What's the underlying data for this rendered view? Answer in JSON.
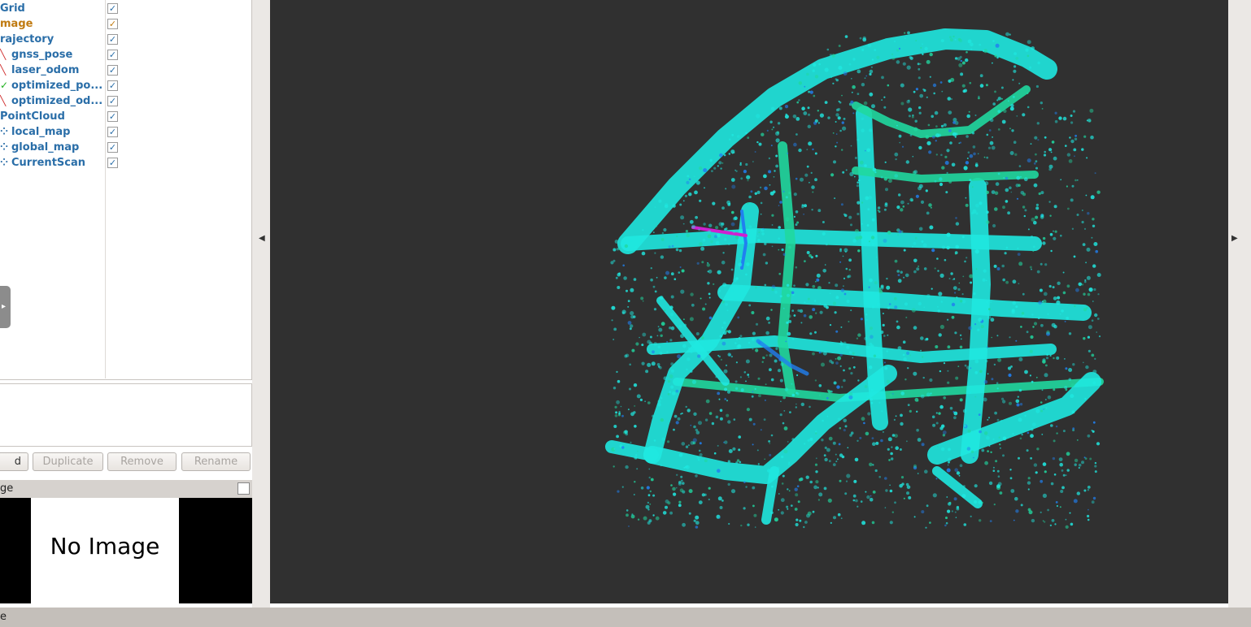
{
  "displays": {
    "items": [
      {
        "label": "Grid",
        "indent": 0,
        "icon": "",
        "checked": "✓",
        "color": "blue"
      },
      {
        "label": "mage",
        "indent": 0,
        "icon": "",
        "checked": "✓",
        "color": "orange"
      },
      {
        "label": "rajectory",
        "indent": 0,
        "icon": "",
        "checked": "✓",
        "color": "blue"
      },
      {
        "label": "gnss_pose",
        "indent": 1,
        "icon": "╲",
        "icon_color": "#d03030",
        "checked": "✓",
        "color": "blue"
      },
      {
        "label": "laser_odom",
        "indent": 1,
        "icon": "╲",
        "icon_color": "#d03030",
        "checked": "✓",
        "color": "blue"
      },
      {
        "label": "optimized_po...",
        "indent": 1,
        "icon": "✓",
        "icon_color": "#20b020",
        "checked": "✓",
        "color": "blue"
      },
      {
        "label": "optimized_od...",
        "indent": 1,
        "icon": "╲",
        "icon_color": "#d03030",
        "checked": "✓",
        "color": "blue"
      },
      {
        "label": "PointCloud",
        "indent": 0,
        "icon": "",
        "checked": "✓",
        "color": "blue"
      },
      {
        "label": "local_map",
        "indent": 1,
        "icon": "⁘",
        "icon_color": "#2a6ea8",
        "checked": "✓",
        "color": "blue"
      },
      {
        "label": "global_map",
        "indent": 1,
        "icon": "⁘",
        "icon_color": "#2a6ea8",
        "checked": "✓",
        "color": "blue"
      },
      {
        "label": "CurrentScan",
        "indent": 1,
        "icon": "⁘",
        "icon_color": "#2a6ea8",
        "checked": "✓",
        "color": "blue"
      }
    ]
  },
  "buttons": {
    "add": "d",
    "duplicate": "Duplicate",
    "remove": "Remove",
    "rename": "Rename"
  },
  "image_panel": {
    "title": "ge",
    "no_image": "No Image"
  },
  "status_bar": {
    "text": "e"
  },
  "colors": {
    "viewport_bg": "#303030",
    "pointcloud_primary": "#1fe8e0",
    "pointcloud_secondary": "#20d8a0",
    "pointcloud_tertiary": "#2080f0",
    "trajectory_magenta": "#d020d0"
  }
}
